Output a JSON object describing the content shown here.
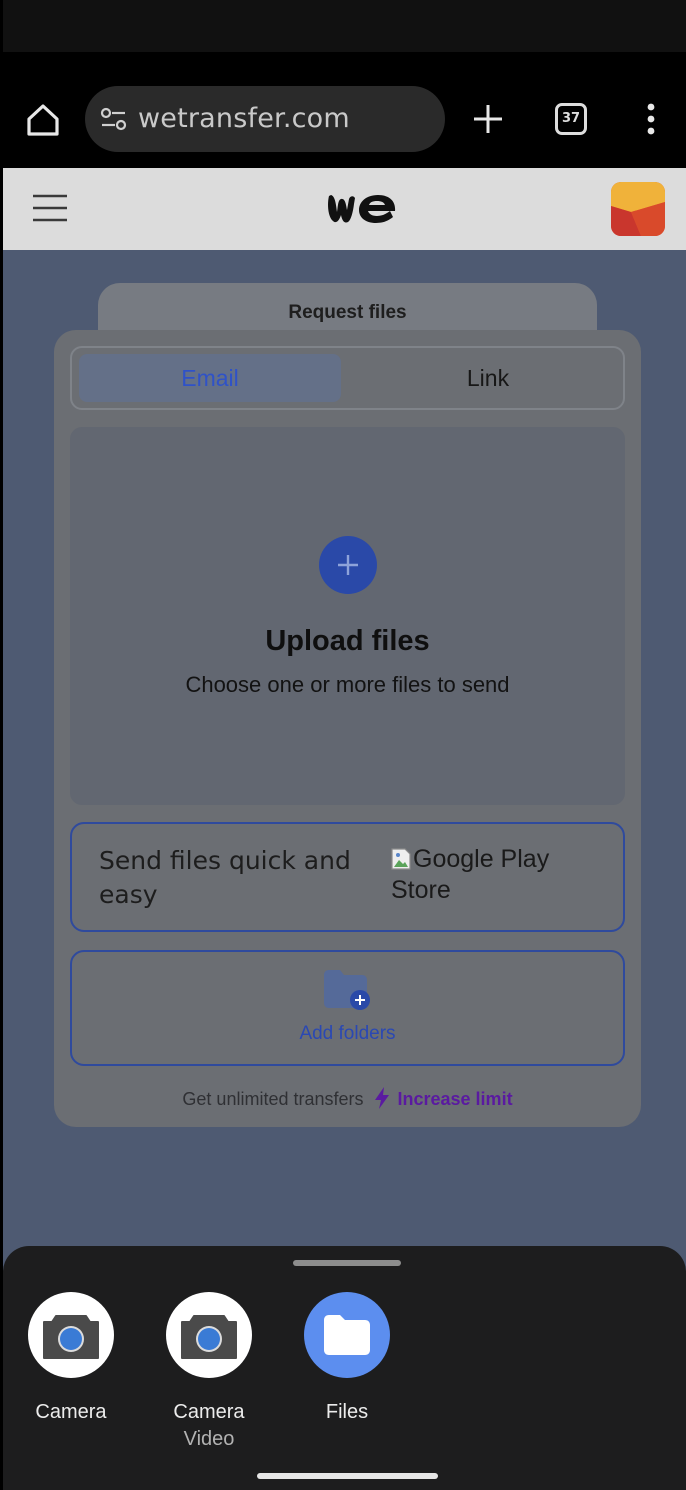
{
  "browser": {
    "url": "wetransfer.com",
    "tab_count": "37"
  },
  "request_tab": {
    "label": "Request files"
  },
  "segmented": {
    "email": "Email",
    "link": "Link"
  },
  "upload": {
    "title": "Upload files",
    "subtitle": "Choose one or more files to send"
  },
  "promo": {
    "text": "Send files quick and easy",
    "image_alt": "Google Play Store"
  },
  "folders": {
    "label": "Add folders"
  },
  "limit": {
    "text": "Get unlimited transfers",
    "link": "Increase limit"
  },
  "sheet": {
    "apps": [
      {
        "label": "Camera",
        "sub": ""
      },
      {
        "label": "Camera",
        "sub": "Video"
      },
      {
        "label": "Files",
        "sub": ""
      }
    ]
  },
  "colors": {
    "brand_blue": "#2a49a8",
    "files_blue": "#5c8eef",
    "upgrade_purple": "#5a1aa0"
  }
}
